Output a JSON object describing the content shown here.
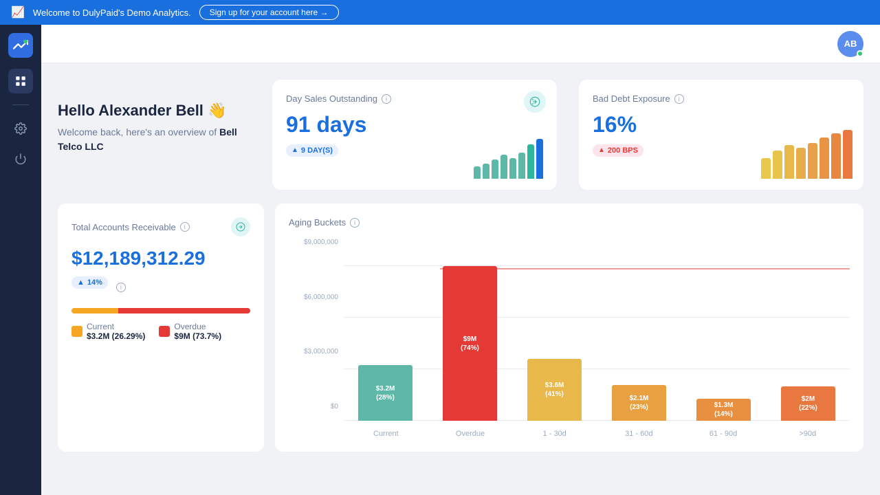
{
  "banner": {
    "welcome_text": "Welcome to DulyPaid's Demo Analytics.",
    "signup_label": "Sign up for your account here →"
  },
  "header": {
    "avatar_initials": "AB",
    "avatar_online": true
  },
  "sidebar": {
    "items": [
      {
        "name": "grid",
        "active": true
      },
      {
        "name": "minus"
      },
      {
        "name": "settings"
      },
      {
        "name": "power"
      }
    ]
  },
  "welcome": {
    "title": "Hello Alexander Bell 👋",
    "subtitle_prefix": "Welcome back, here's an overview of ",
    "company": "Bell Telco LLC"
  },
  "dso_card": {
    "title": "Day Sales Outstanding",
    "value": "91 days",
    "badge": "9 DAY(S)",
    "chart_bars": [
      18,
      22,
      28,
      35,
      30,
      38,
      50,
      58
    ],
    "chart_colors": [
      "#5db8a8",
      "#5db8a8",
      "#5db8a8",
      "#5db8a8",
      "#5db8a8",
      "#5db8a8",
      "#2db89e",
      "#1a6fdf"
    ]
  },
  "bad_debt_card": {
    "title": "Bad Debt Exposure",
    "value": "16%",
    "badge": "200 BPS",
    "chart_bars": [
      40,
      55,
      65,
      60,
      70,
      80,
      88,
      95
    ],
    "chart_colors": [
      "#e8c84a",
      "#e8c44a",
      "#e8b84a",
      "#e8ac4a",
      "#e8a04a",
      "#e89444",
      "#e88840",
      "#e87840"
    ]
  },
  "ar_card": {
    "title": "Total Accounts Receivable",
    "value": "$12,189,312.29",
    "badge": "14%",
    "current_label": "Current",
    "current_value": "$3.2M (26.29%)",
    "overdue_label": "Overdue",
    "overdue_value": "$9M (73.7%)"
  },
  "aging": {
    "title": "Aging Buckets",
    "y_labels": [
      "$0",
      "$3,000,000",
      "$6,000,000",
      "$9,000,000"
    ],
    "bars": [
      {
        "label": "Current",
        "value": 3200000,
        "display": "$3.2M (28%)",
        "color": "#5db8a8",
        "height_pct": 36
      },
      {
        "label": "Overdue",
        "value": 9000000,
        "display": "$9M (74%)",
        "color": "#e53935",
        "height_pct": 100
      },
      {
        "label": "1 - 30d",
        "value": 3600000,
        "display": "$3.6M (41%)",
        "color": "#e8b84a",
        "height_pct": 40
      },
      {
        "label": "31 - 60d",
        "value": 2100000,
        "display": "$2.1M (23%)",
        "color": "#e8a040",
        "height_pct": 23
      },
      {
        "label": "61 - 90d",
        "value": 1300000,
        "display": "$1.3M (14%)",
        "color": "#e89040",
        "height_pct": 14
      },
      {
        "label": ">90d",
        "value": 2000000,
        "display": "$2M (22%)",
        "color": "#e87840",
        "height_pct": 22
      }
    ]
  }
}
